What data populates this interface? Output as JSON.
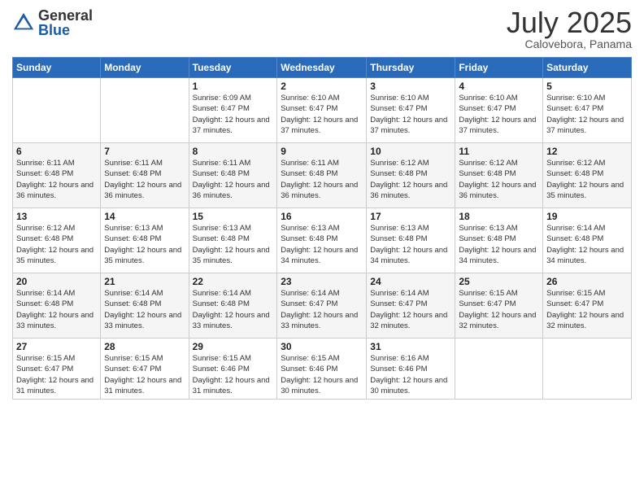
{
  "logo": {
    "general": "General",
    "blue": "Blue"
  },
  "title": "July 2025",
  "location": "Calovebora, Panama",
  "days_header": [
    "Sunday",
    "Monday",
    "Tuesday",
    "Wednesday",
    "Thursday",
    "Friday",
    "Saturday"
  ],
  "weeks": [
    [
      {
        "day": "",
        "info": ""
      },
      {
        "day": "",
        "info": ""
      },
      {
        "day": "1",
        "info": "Sunrise: 6:09 AM\nSunset: 6:47 PM\nDaylight: 12 hours and 37 minutes."
      },
      {
        "day": "2",
        "info": "Sunrise: 6:10 AM\nSunset: 6:47 PM\nDaylight: 12 hours and 37 minutes."
      },
      {
        "day": "3",
        "info": "Sunrise: 6:10 AM\nSunset: 6:47 PM\nDaylight: 12 hours and 37 minutes."
      },
      {
        "day": "4",
        "info": "Sunrise: 6:10 AM\nSunset: 6:47 PM\nDaylight: 12 hours and 37 minutes."
      },
      {
        "day": "5",
        "info": "Sunrise: 6:10 AM\nSunset: 6:47 PM\nDaylight: 12 hours and 37 minutes."
      }
    ],
    [
      {
        "day": "6",
        "info": "Sunrise: 6:11 AM\nSunset: 6:48 PM\nDaylight: 12 hours and 36 minutes."
      },
      {
        "day": "7",
        "info": "Sunrise: 6:11 AM\nSunset: 6:48 PM\nDaylight: 12 hours and 36 minutes."
      },
      {
        "day": "8",
        "info": "Sunrise: 6:11 AM\nSunset: 6:48 PM\nDaylight: 12 hours and 36 minutes."
      },
      {
        "day": "9",
        "info": "Sunrise: 6:11 AM\nSunset: 6:48 PM\nDaylight: 12 hours and 36 minutes."
      },
      {
        "day": "10",
        "info": "Sunrise: 6:12 AM\nSunset: 6:48 PM\nDaylight: 12 hours and 36 minutes."
      },
      {
        "day": "11",
        "info": "Sunrise: 6:12 AM\nSunset: 6:48 PM\nDaylight: 12 hours and 36 minutes."
      },
      {
        "day": "12",
        "info": "Sunrise: 6:12 AM\nSunset: 6:48 PM\nDaylight: 12 hours and 35 minutes."
      }
    ],
    [
      {
        "day": "13",
        "info": "Sunrise: 6:12 AM\nSunset: 6:48 PM\nDaylight: 12 hours and 35 minutes."
      },
      {
        "day": "14",
        "info": "Sunrise: 6:13 AM\nSunset: 6:48 PM\nDaylight: 12 hours and 35 minutes."
      },
      {
        "day": "15",
        "info": "Sunrise: 6:13 AM\nSunset: 6:48 PM\nDaylight: 12 hours and 35 minutes."
      },
      {
        "day": "16",
        "info": "Sunrise: 6:13 AM\nSunset: 6:48 PM\nDaylight: 12 hours and 34 minutes."
      },
      {
        "day": "17",
        "info": "Sunrise: 6:13 AM\nSunset: 6:48 PM\nDaylight: 12 hours and 34 minutes."
      },
      {
        "day": "18",
        "info": "Sunrise: 6:13 AM\nSunset: 6:48 PM\nDaylight: 12 hours and 34 minutes."
      },
      {
        "day": "19",
        "info": "Sunrise: 6:14 AM\nSunset: 6:48 PM\nDaylight: 12 hours and 34 minutes."
      }
    ],
    [
      {
        "day": "20",
        "info": "Sunrise: 6:14 AM\nSunset: 6:48 PM\nDaylight: 12 hours and 33 minutes."
      },
      {
        "day": "21",
        "info": "Sunrise: 6:14 AM\nSunset: 6:48 PM\nDaylight: 12 hours and 33 minutes."
      },
      {
        "day": "22",
        "info": "Sunrise: 6:14 AM\nSunset: 6:48 PM\nDaylight: 12 hours and 33 minutes."
      },
      {
        "day": "23",
        "info": "Sunrise: 6:14 AM\nSunset: 6:47 PM\nDaylight: 12 hours and 33 minutes."
      },
      {
        "day": "24",
        "info": "Sunrise: 6:14 AM\nSunset: 6:47 PM\nDaylight: 12 hours and 32 minutes."
      },
      {
        "day": "25",
        "info": "Sunrise: 6:15 AM\nSunset: 6:47 PM\nDaylight: 12 hours and 32 minutes."
      },
      {
        "day": "26",
        "info": "Sunrise: 6:15 AM\nSunset: 6:47 PM\nDaylight: 12 hours and 32 minutes."
      }
    ],
    [
      {
        "day": "27",
        "info": "Sunrise: 6:15 AM\nSunset: 6:47 PM\nDaylight: 12 hours and 31 minutes."
      },
      {
        "day": "28",
        "info": "Sunrise: 6:15 AM\nSunset: 6:47 PM\nDaylight: 12 hours and 31 minutes."
      },
      {
        "day": "29",
        "info": "Sunrise: 6:15 AM\nSunset: 6:46 PM\nDaylight: 12 hours and 31 minutes."
      },
      {
        "day": "30",
        "info": "Sunrise: 6:15 AM\nSunset: 6:46 PM\nDaylight: 12 hours and 30 minutes."
      },
      {
        "day": "31",
        "info": "Sunrise: 6:16 AM\nSunset: 6:46 PM\nDaylight: 12 hours and 30 minutes."
      },
      {
        "day": "",
        "info": ""
      },
      {
        "day": "",
        "info": ""
      }
    ]
  ]
}
